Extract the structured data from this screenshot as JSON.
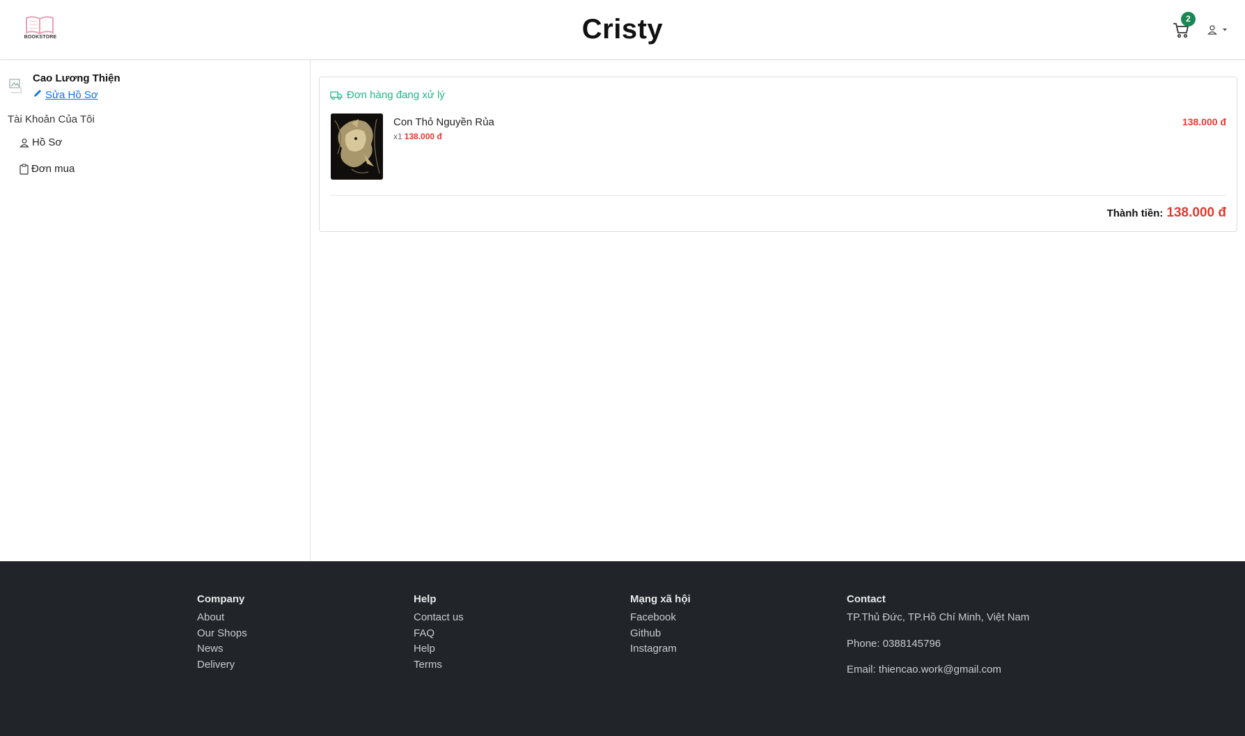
{
  "header": {
    "logo_text": "BOOKSTORE",
    "brand": "Cristy",
    "cart_count": "2",
    "accent_badge_color": "#198754"
  },
  "sidebar": {
    "user_name": "Cao Lương Thiện",
    "edit_profile": "Sửa Hồ Sơ",
    "account_title": "Tài Khoản Của Tôi",
    "links": [
      {
        "label": "Hồ Sơ",
        "icon": "person-icon"
      },
      {
        "label": "Đơn mua",
        "icon": "clipboard-icon"
      }
    ]
  },
  "order": {
    "status": "Đơn hàng đang xử lý",
    "status_color": "#20b387",
    "item": {
      "title": "Con Thỏ Nguyền Rủa",
      "qty": "x1",
      "unit_price": "138.000 đ",
      "line_total": "138.000 đ"
    },
    "total_label": "Thành tiền:",
    "total_value": "138.000 đ",
    "price_color": "#e03a2f"
  },
  "footer": {
    "company": {
      "title": "Company",
      "links": [
        "About",
        "Our Shops",
        "News",
        "Delivery"
      ]
    },
    "help": {
      "title": "Help",
      "links": [
        "Contact us",
        "FAQ",
        "Help",
        "Terms"
      ]
    },
    "social": {
      "title": "Mạng xã hội",
      "links": [
        "Facebook",
        "Github",
        "Instagram"
      ]
    },
    "contact": {
      "title": "Contact",
      "address": "TP.Thủ Đức, TP.Hồ Chí Minh, Việt Nam",
      "phone": "Phone: 0388145796",
      "email": "Email: thiencao.work@gmail.com"
    }
  }
}
